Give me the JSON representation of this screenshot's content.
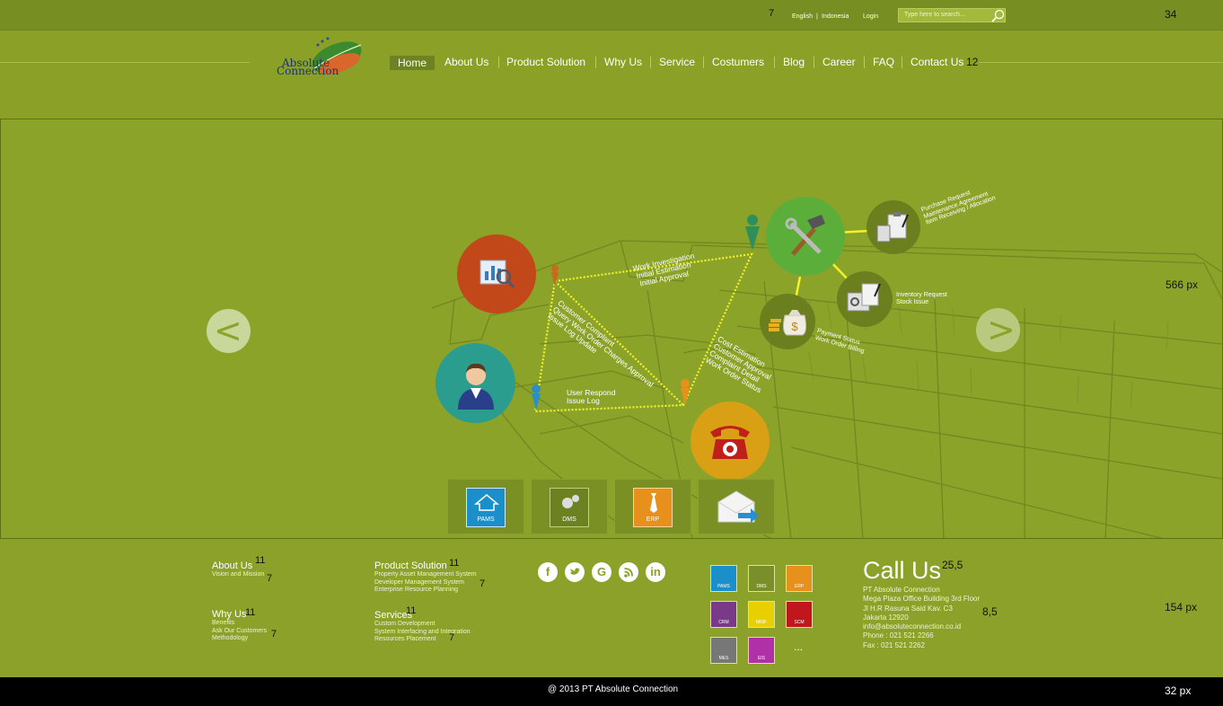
{
  "topbar": {
    "lang_english": "English",
    "lang_sep": "|",
    "lang_indonesia": "Indonesia",
    "login": "Login",
    "search_placeholder": "Type here to search...",
    "spec_font_size": "7",
    "spec_height": "34"
  },
  "logo": {
    "line1": "Absolute",
    "line2": "Connection"
  },
  "nav": {
    "items": [
      "Home",
      "About Us",
      "Product Solution",
      "Why Us",
      "Service",
      "Costumers",
      "Blog",
      "Career",
      "FAQ",
      "Contact Us"
    ],
    "spec_font_size": "12"
  },
  "hero": {
    "spec_height": "566 px",
    "prev": "<",
    "next": ">",
    "labels": {
      "work": [
        "Work Investigation",
        "Initial Estimation",
        "Initial Approval"
      ],
      "complaint": [
        "Customer Complaint",
        "Query Work Order Charges Approval",
        "Issue Log Update"
      ],
      "respond": [
        "User Respond",
        "Issue Log"
      ],
      "cost": [
        "Cost Estimation",
        "Customer Approval",
        "Complaint Detail",
        "Work Order Status"
      ],
      "purchase": [
        "Purchase Request",
        "Maintenance Agreement",
        "Item Receiving / Allocation"
      ],
      "inventory": [
        "Inventory Request",
        "Stock Issue"
      ],
      "payment": [
        "Payment Status",
        "Work Order Billing"
      ]
    },
    "tiles": [
      {
        "label": "PAMS",
        "color": "#1a8fc9"
      },
      {
        "label": "DMS",
        "color": "#7a8f2a"
      },
      {
        "label": "ERP",
        "color": "#e8901c"
      },
      {
        "label": "",
        "color": "#ffffff"
      }
    ]
  },
  "footer": {
    "about": {
      "title": "About Us",
      "items": [
        "Vision and Mission"
      ],
      "spec_title": "11",
      "spec_items": "7"
    },
    "product": {
      "title": "Product Solution",
      "items": [
        "Property Asset Management System",
        "Developer Management System",
        "Enterprise Resource Planning"
      ],
      "spec_title": "11",
      "spec_items": "7"
    },
    "whyus": {
      "title": "Why Us",
      "items": [
        "Benefits",
        "Ask Our Customers",
        "Methodology"
      ],
      "spec_title": "11",
      "spec_items": "7"
    },
    "services": {
      "title": "Services",
      "items": [
        "Custom Development",
        "System Interfacing and Integration",
        "Resources Placement"
      ],
      "spec_title": "11",
      "spec_items": "7"
    },
    "social_icons": [
      "facebook-icon",
      "twitter-icon",
      "google-icon",
      "rss-icon",
      "linkedin-icon"
    ],
    "products": [
      {
        "label": "PAMS",
        "color": "#1a8fc9"
      },
      {
        "label": "DMS",
        "color": "#7a8f2a"
      },
      {
        "label": "ERP",
        "color": "#e8901c"
      },
      {
        "label": "CRM",
        "color": "#7a3a8a"
      },
      {
        "label": "MINF",
        "color": "#e8d000"
      },
      {
        "label": "SCM",
        "color": "#c0161e"
      },
      {
        "label": "MES",
        "color": "#777777"
      },
      {
        "label": "EIS",
        "color": "#b030a8"
      }
    ],
    "more": "...",
    "call": {
      "title": "Call Us",
      "spec_title": "25,5",
      "spec_info": "8,5",
      "lines": [
        "PT Absolute Connection",
        "Mega Plaza Office Building 3rd Floor",
        "Jl H.R Rasuna Said Kav. C3",
        "Jakarta 12920",
        "info@absoluteconnection.co.id",
        "Phone : 021 521 2266",
        "Fax : 021 521 2262"
      ]
    },
    "spec_height": "154 px"
  },
  "bottombar": {
    "copyright": "@ 2013 PT Absolute Connection",
    "spec_height": "32 px"
  }
}
